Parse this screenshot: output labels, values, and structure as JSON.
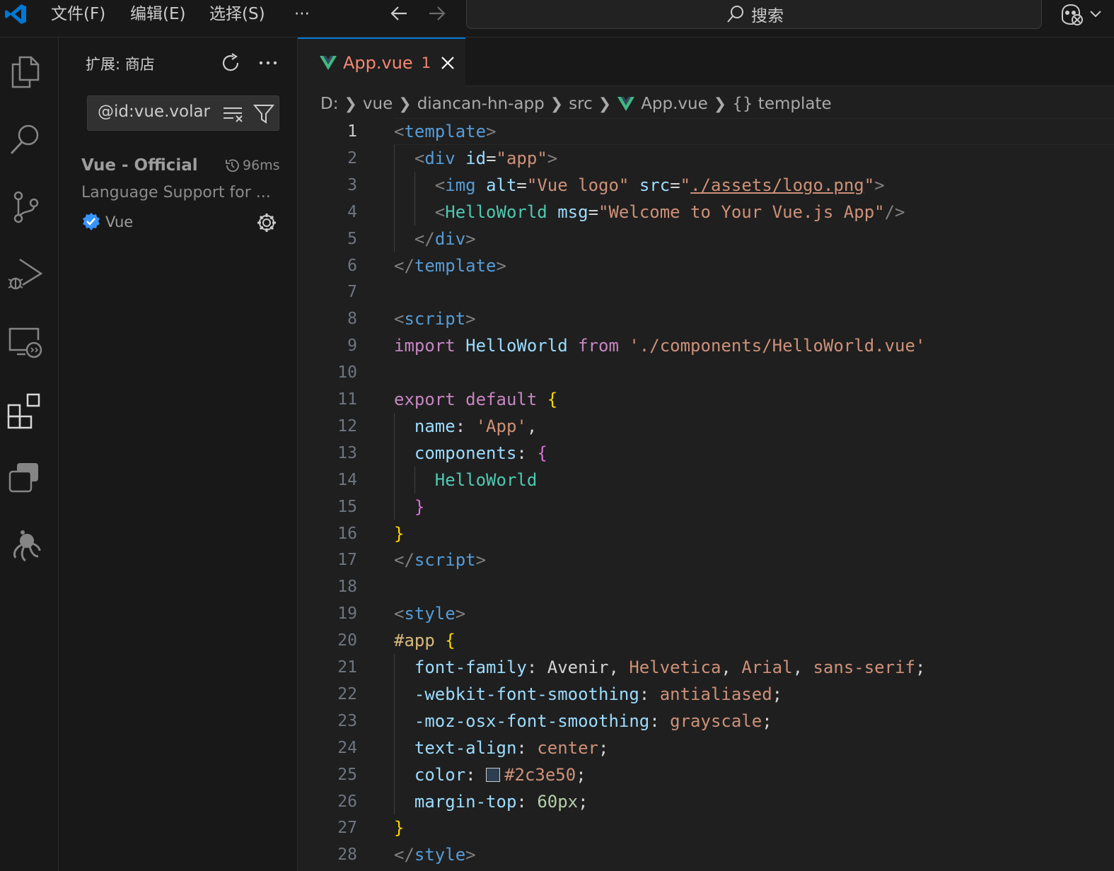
{
  "menu": {
    "file": "文件(F)",
    "edit": "编辑(E)",
    "select": "选择(S)",
    "more": "···"
  },
  "search": {
    "label": "搜索"
  },
  "sidebar": {
    "title": "扩展: 商店",
    "search_value": "@id:vue.volar",
    "extension": {
      "name": "Vue - Official",
      "time": "96ms",
      "description": "Language Support for ...",
      "publisher": "Vue"
    }
  },
  "tab": {
    "name": "App.vue",
    "problems": "1"
  },
  "breadcrumb": [
    "D:",
    "vue",
    "diancan-hn-app",
    "src",
    "App.vue",
    "{} template"
  ],
  "editor": {
    "active_line": 1,
    "line_numbers": [
      "1",
      "2",
      "3",
      "4",
      "5",
      "6",
      "7",
      "8",
      "9",
      "10",
      "11",
      "12",
      "13",
      "14",
      "15",
      "16",
      "17",
      "18",
      "19",
      "20",
      "21",
      "22",
      "23",
      "24",
      "25",
      "26",
      "27",
      "28"
    ],
    "lines": [
      [
        [
          "p",
          "<"
        ],
        [
          "t",
          "template"
        ],
        [
          "p",
          ">"
        ]
      ],
      [
        [
          "s",
          "  "
        ],
        [
          "p",
          "<"
        ],
        [
          "t",
          "div"
        ],
        [
          "s",
          " "
        ],
        [
          "a",
          "id"
        ],
        [
          "s",
          "="
        ],
        [
          "r",
          "\"app\""
        ],
        [
          "p",
          ">"
        ]
      ],
      [
        [
          "s",
          "    "
        ],
        [
          "p",
          "<"
        ],
        [
          "t",
          "img"
        ],
        [
          "s",
          " "
        ],
        [
          "a",
          "alt"
        ],
        [
          "s",
          "="
        ],
        [
          "r",
          "\"Vue logo\""
        ],
        [
          "s",
          " "
        ],
        [
          "a",
          "src"
        ],
        [
          "s",
          "="
        ],
        [
          "r",
          "\""
        ],
        [
          "ru",
          "./assets/logo.png"
        ],
        [
          "r",
          "\""
        ],
        [
          "p",
          ">"
        ]
      ],
      [
        [
          "s",
          "    "
        ],
        [
          "p",
          "<"
        ],
        [
          "c",
          "HelloWorld"
        ],
        [
          "s",
          " "
        ],
        [
          "a",
          "msg"
        ],
        [
          "s",
          "="
        ],
        [
          "r",
          "\"Welcome to Your Vue.js App\""
        ],
        [
          "p",
          "/>"
        ]
      ],
      [
        [
          "s",
          "  "
        ],
        [
          "p",
          "</"
        ],
        [
          "t",
          "div"
        ],
        [
          "p",
          ">"
        ]
      ],
      [
        [
          "p",
          "</"
        ],
        [
          "t",
          "template"
        ],
        [
          "p",
          ">"
        ]
      ],
      [],
      [
        [
          "p",
          "<"
        ],
        [
          "t",
          "script"
        ],
        [
          "p",
          ">"
        ]
      ],
      [
        [
          "k",
          "import"
        ],
        [
          "s",
          " "
        ],
        [
          "i",
          "HelloWorld"
        ],
        [
          "s",
          " "
        ],
        [
          "k",
          "from"
        ],
        [
          "s",
          " "
        ],
        [
          "r",
          "'./components/HelloWorld.vue'"
        ]
      ],
      [],
      [
        [
          "k",
          "export"
        ],
        [
          "s",
          " "
        ],
        [
          "k",
          "default"
        ],
        [
          "s",
          " "
        ],
        [
          "b1",
          "{"
        ]
      ],
      [
        [
          "s",
          "  "
        ],
        [
          "i",
          "name"
        ],
        [
          "s",
          ": "
        ],
        [
          "r",
          "'App'"
        ],
        [
          "s",
          ","
        ]
      ],
      [
        [
          "s",
          "  "
        ],
        [
          "i",
          "components"
        ],
        [
          "s",
          ": "
        ],
        [
          "b2",
          "{"
        ]
      ],
      [
        [
          "s",
          "    "
        ],
        [
          "c",
          "HelloWorld"
        ]
      ],
      [
        [
          "s",
          "  "
        ],
        [
          "b2",
          "}"
        ]
      ],
      [
        [
          "b1",
          "}"
        ]
      ],
      [
        [
          "p",
          "</"
        ],
        [
          "t",
          "script"
        ],
        [
          "p",
          ">"
        ]
      ],
      [],
      [
        [
          "p",
          "<"
        ],
        [
          "t",
          "style"
        ],
        [
          "p",
          ">"
        ]
      ],
      [
        [
          "x",
          "#app"
        ],
        [
          "s",
          " "
        ],
        [
          "b1",
          "{"
        ]
      ],
      [
        [
          "s",
          "  "
        ],
        [
          "i",
          "font-family"
        ],
        [
          "s",
          ": Avenir, "
        ],
        [
          "r",
          "Helvetica"
        ],
        [
          "s",
          ", "
        ],
        [
          "r",
          "Arial"
        ],
        [
          "s",
          ", "
        ],
        [
          "r",
          "sans-serif"
        ],
        [
          "s",
          ";"
        ]
      ],
      [
        [
          "s",
          "  "
        ],
        [
          "i",
          "-webkit-font-smoothing"
        ],
        [
          "s",
          ": "
        ],
        [
          "r",
          "antialiased"
        ],
        [
          "s",
          ";"
        ]
      ],
      [
        [
          "s",
          "  "
        ],
        [
          "i",
          "-moz-osx-font-smoothing"
        ],
        [
          "s",
          ": "
        ],
        [
          "r",
          "grayscale"
        ],
        [
          "s",
          ";"
        ]
      ],
      [
        [
          "s",
          "  "
        ],
        [
          "i",
          "text-align"
        ],
        [
          "s",
          ": "
        ],
        [
          "r",
          "center"
        ],
        [
          "s",
          ";"
        ]
      ],
      [
        [
          "s",
          "  "
        ],
        [
          "i",
          "color"
        ],
        [
          "s",
          ": "
        ],
        [
          "sw",
          ""
        ],
        [
          "r",
          "#2c3e50"
        ],
        [
          "s",
          ";"
        ]
      ],
      [
        [
          "s",
          "  "
        ],
        [
          "i",
          "margin-top"
        ],
        [
          "s",
          ": "
        ],
        [
          "n",
          "60px"
        ],
        [
          "s",
          ";"
        ]
      ],
      [
        [
          "b1",
          "}"
        ]
      ],
      [
        [
          "p",
          "</"
        ],
        [
          "t",
          "style"
        ],
        [
          "p",
          ">"
        ]
      ]
    ]
  },
  "colors": {
    "accent": "#0078d4",
    "vue_green": "#41b883",
    "error": "#f48771",
    "verified": "#3794ff"
  }
}
